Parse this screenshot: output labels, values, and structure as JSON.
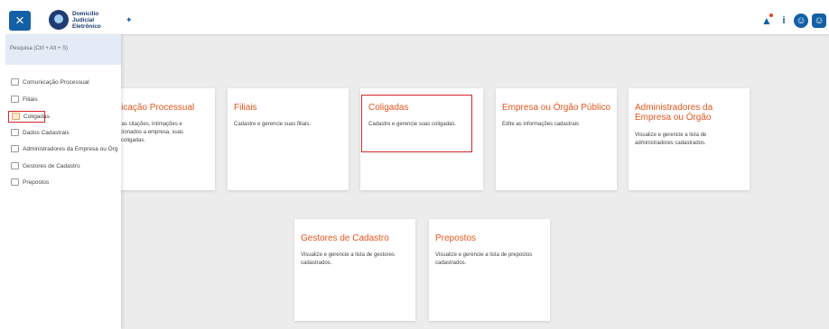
{
  "topbar": {
    "close_icon": "×",
    "brand_line1": "Domicílio",
    "brand_line2": "Judicial",
    "brand_line3": "Eletrônico",
    "pin_icon": "✦",
    "info_icon": "i",
    "accessibility_icon": "☺",
    "user_icon": "☺"
  },
  "sidebar": {
    "search_placeholder": "Pesquisa (Ctrl + Alt + S)",
    "items": [
      {
        "label": "Comunicação Processual"
      },
      {
        "label": "Filiais"
      },
      {
        "label": "Coligadas"
      },
      {
        "label": "Dados Cadastrais"
      },
      {
        "label": "Administradores da Empresa ou Órg"
      },
      {
        "label": "Gestores de Cadastro"
      },
      {
        "label": "Prepostos"
      }
    ]
  },
  "cards": [
    {
      "title": "unicação Processual",
      "desc1": "nhe as citações, intimações e",
      "desc2": "direcionados a empresa, suas",
      "desc3": "coligadas."
    },
    {
      "title": "Filiais",
      "desc1": "Cadastre e gerencie suas filiais."
    },
    {
      "title": "Coligadas",
      "desc1": "Cadastre e gerencie suas coligadas."
    },
    {
      "title": "Empresa ou Órgão Público",
      "desc1": "Edite as informações cadastrais"
    },
    {
      "title1": "Administradores da",
      "title2": "Empresa ou Órgão",
      "desc1": "Visualize e gerencie a lista de",
      "desc2": "administradores cadastrados."
    },
    {
      "title": "Gestores de Cadastro",
      "desc1": "Visualize e gerencie a lista de gestores",
      "desc2": "cadastrados."
    },
    {
      "title": "Prepostos",
      "desc1": "Visualize e gerencie a lista de prepostos",
      "desc2": "cadastrados."
    }
  ],
  "colors": {
    "primary": "#1360a6",
    "accent": "#e8541c",
    "highlight": "#d9242d"
  }
}
